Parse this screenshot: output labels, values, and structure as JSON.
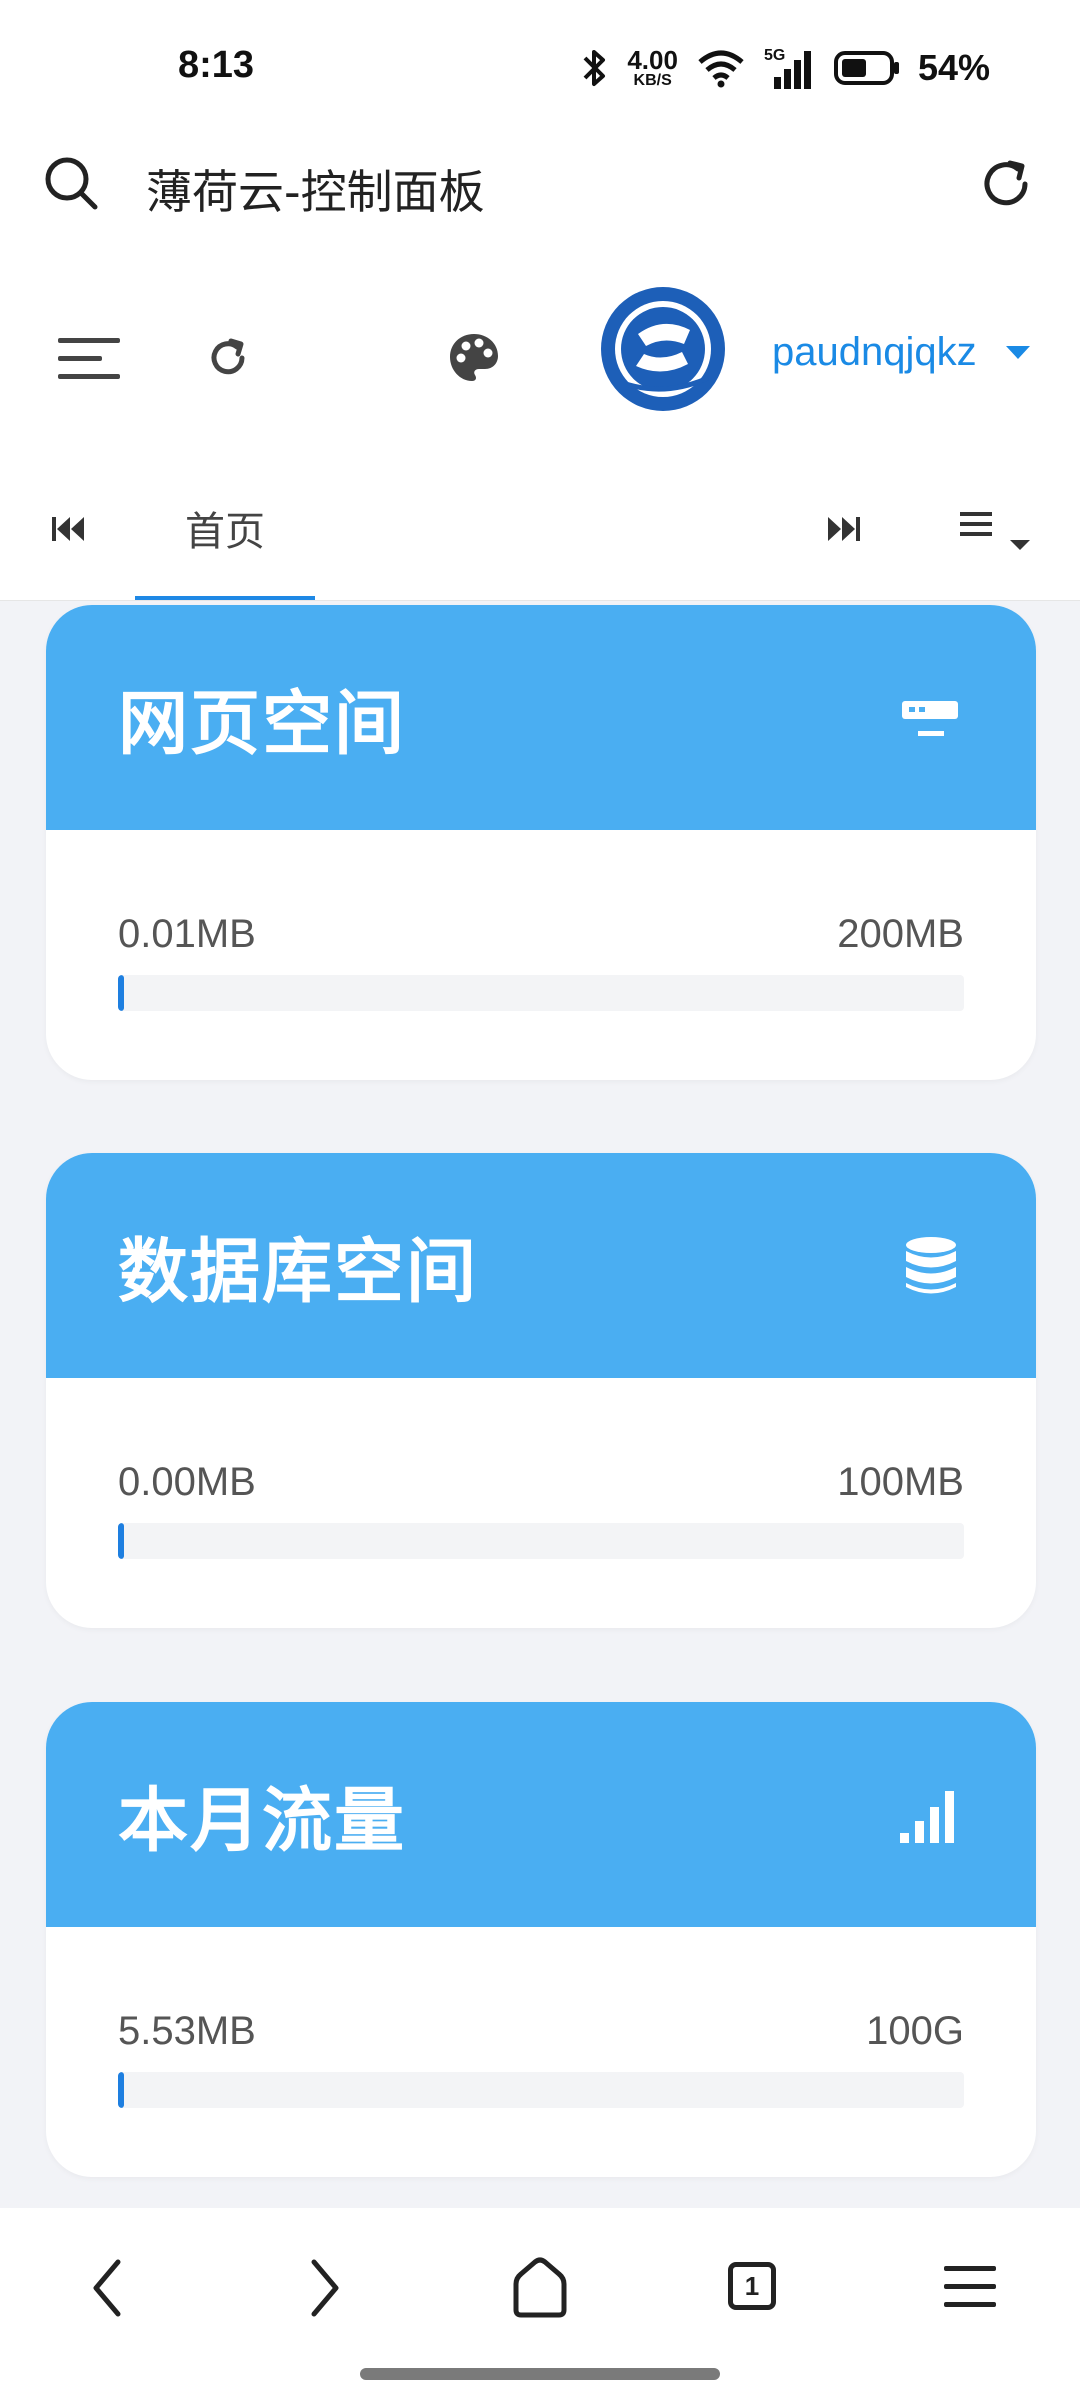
{
  "status_bar": {
    "time": "8:13",
    "net_speed_value": "4.00",
    "net_speed_unit": "KB/S",
    "network_type": "5G",
    "battery": "54%"
  },
  "browser": {
    "page_title": "薄荷云-控制面板"
  },
  "header": {
    "username": "paudnqjqkz"
  },
  "tabs": {
    "home": "首页"
  },
  "cards": [
    {
      "title": "网页空间",
      "icon": "server-icon",
      "used": "0.01MB",
      "total": "200MB",
      "fraction": 0.0001
    },
    {
      "title": "数据库空间",
      "icon": "database-icon",
      "used": "0.00MB",
      "total": "100MB",
      "fraction": 0.0
    },
    {
      "title": "本月流量",
      "icon": "signal-bars-icon",
      "used": "5.53MB",
      "total": "100G",
      "fraction": 0.0001
    }
  ],
  "bottom_nav": {
    "tab_count": "1"
  },
  "colors": {
    "card_header": "#4aaef2",
    "progress_fill": "#1e7fe0",
    "accent": "#1a8ae5"
  }
}
